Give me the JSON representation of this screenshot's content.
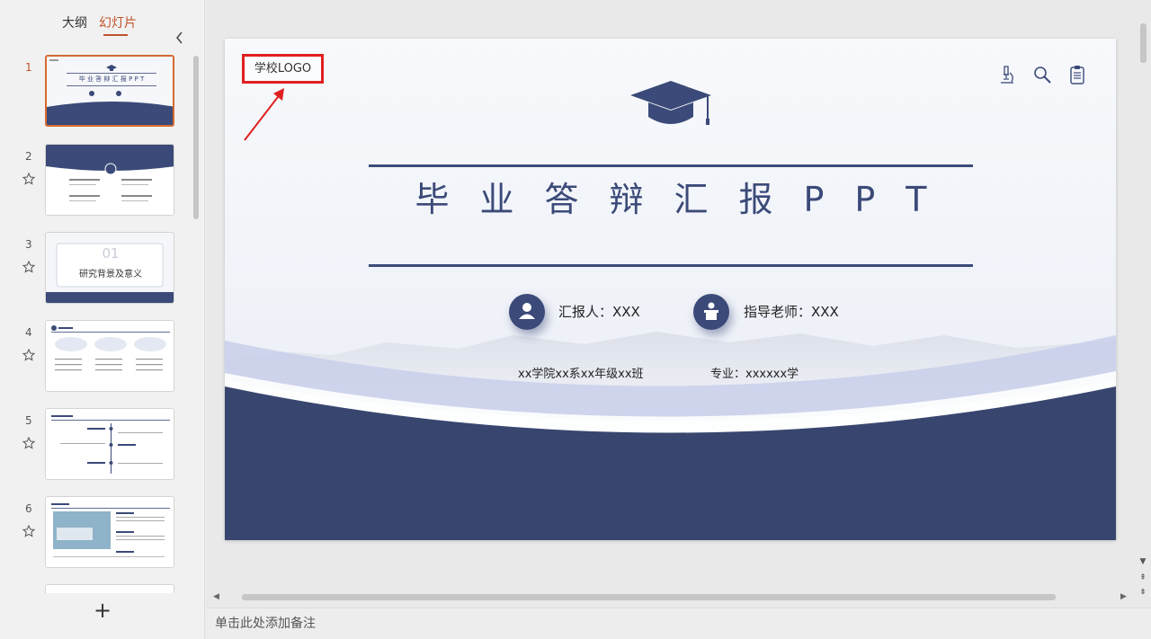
{
  "panel": {
    "tabs": [
      {
        "label": "大纲"
      },
      {
        "label": "幻灯片"
      }
    ],
    "active_tab": "幻灯片",
    "slides": [
      {
        "number": "1",
        "title": "毕 业 答 辩 汇 报 P P T"
      },
      {
        "number": "2"
      },
      {
        "number": "3",
        "heading": "01",
        "title": "研究背景及意义"
      },
      {
        "number": "4"
      },
      {
        "number": "5"
      },
      {
        "number": "6"
      }
    ],
    "add_label": "+"
  },
  "slide": {
    "logo": "学校LOGO",
    "title": "毕业答辩汇报PPT",
    "reporter": "汇报人：XXX",
    "advisor": "指导老师：XXX",
    "class_info": "xx学院xx系xx年级xx班",
    "major": "专业：xxxxxx学",
    "top_icons": [
      "microscope-icon",
      "search-icon",
      "clipboard-icon"
    ],
    "colors": {
      "primary": "#3b4a78",
      "highlight_box": "#e02020",
      "accent_tab": "#c0532a"
    }
  },
  "notes": {
    "placeholder": "单击此处添加备注"
  }
}
